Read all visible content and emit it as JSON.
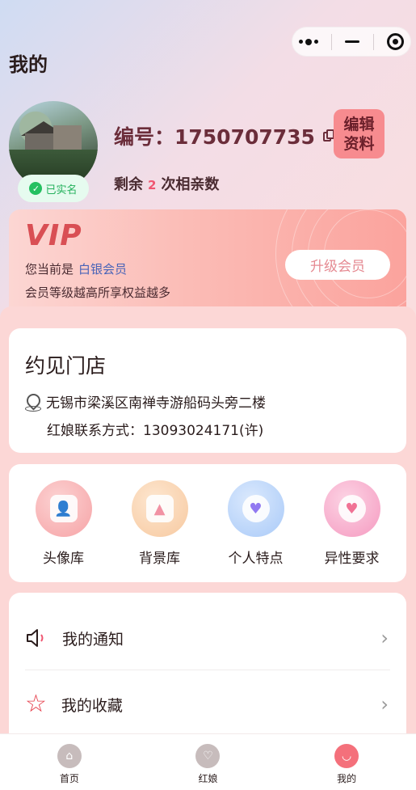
{
  "header": {
    "title": "我的"
  },
  "profile": {
    "verified_label": "已实名",
    "id_label": "编号：1750707735",
    "edit_label_line1": "编辑",
    "edit_label_line2": "资料",
    "remain_prefix": "剩余",
    "remain_count": "2",
    "remain_suffix": "次相亲数"
  },
  "vip": {
    "logo": "VIP",
    "status_prefix": "您当前是",
    "level": "白银会员",
    "desc": "会员等级越高所享权益越多",
    "upgrade_label": "升级会员"
  },
  "store": {
    "title": "约见门店",
    "address": "无锡市梁溪区南禅寺游船码头旁二楼",
    "contact": "红娘联系方式：13093024171(许)"
  },
  "features": [
    {
      "label": "头像库",
      "icon": "avatar-library-icon",
      "color": "#f8b3b3"
    },
    {
      "label": "背景库",
      "icon": "background-library-icon",
      "color": "#f9d7b5"
    },
    {
      "label": "个人特点",
      "icon": "personal-traits-icon",
      "color": "#bdd8fb"
    },
    {
      "label": "异性要求",
      "icon": "partner-requirements-icon",
      "color": "#f9b6d2"
    }
  ],
  "menu": [
    {
      "label": "我的通知",
      "icon": "speaker-icon"
    },
    {
      "label": "我的收藏",
      "icon": "star-icon"
    }
  ],
  "tabbar": [
    {
      "label": "首页",
      "icon": "home-tab-icon"
    },
    {
      "label": "红娘",
      "icon": "matchmaker-tab-icon"
    },
    {
      "label": "我的",
      "icon": "profile-tab-icon",
      "active": true
    }
  ],
  "colors": {
    "accent": "#f05671",
    "edit_button": "#f78b8f",
    "vip_logo": "#d94f54",
    "vip_level": "#4863b8"
  }
}
